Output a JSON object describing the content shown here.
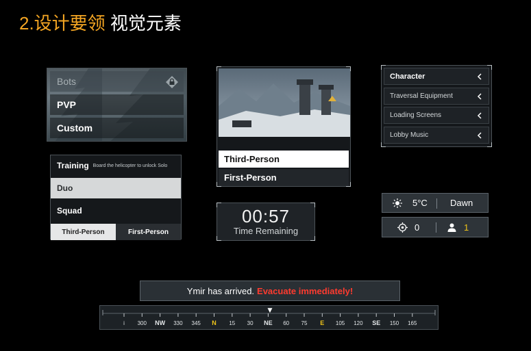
{
  "title": {
    "number": "2.设计要领",
    "rest": "视觉元素"
  },
  "mode_menu": {
    "items": [
      "Bots",
      "PVP",
      "Custom"
    ],
    "locked_icon": "lock-icon"
  },
  "squad_panel": {
    "rows": [
      {
        "label": "Training",
        "hint": "Board the helicopter to unlock Solo"
      },
      {
        "label": "Duo"
      },
      {
        "label": "Squad"
      }
    ],
    "tabs": [
      "Third-Person",
      "First-Person"
    ]
  },
  "camera_panel": {
    "options": [
      "Third-Person",
      "First-Person"
    ]
  },
  "timer": {
    "time": "00:57",
    "label": "Time Remaining"
  },
  "settings_list": {
    "items": [
      "Character",
      "Traversal Equipment",
      "Loading Screens",
      "Lobby Music"
    ]
  },
  "weather": {
    "temperature": "5°C",
    "time_of_day": "Dawn",
    "icon": "sun-icon"
  },
  "status": {
    "target_count": "0",
    "player_count": "1",
    "icons": [
      "crosshair-icon",
      "person-icon"
    ]
  },
  "notice": {
    "message": "Ymir has arrived.",
    "warning": "Evacuate immediately!"
  },
  "compass": {
    "labels": [
      "i",
      "300",
      "NW",
      "330",
      "345",
      "N",
      "15",
      "30",
      "NE",
      "60",
      "75",
      "E",
      "105",
      "120",
      "SE",
      "150",
      "165"
    ],
    "highlight": [
      "N",
      "E"
    ],
    "cardinal": [
      "NW",
      "NE",
      "SE"
    ],
    "marker": "▼"
  },
  "colors": {
    "accent_orange": "#f5a623",
    "warning_red": "#ff3b2f",
    "compass_yellow": "#f0c419"
  }
}
